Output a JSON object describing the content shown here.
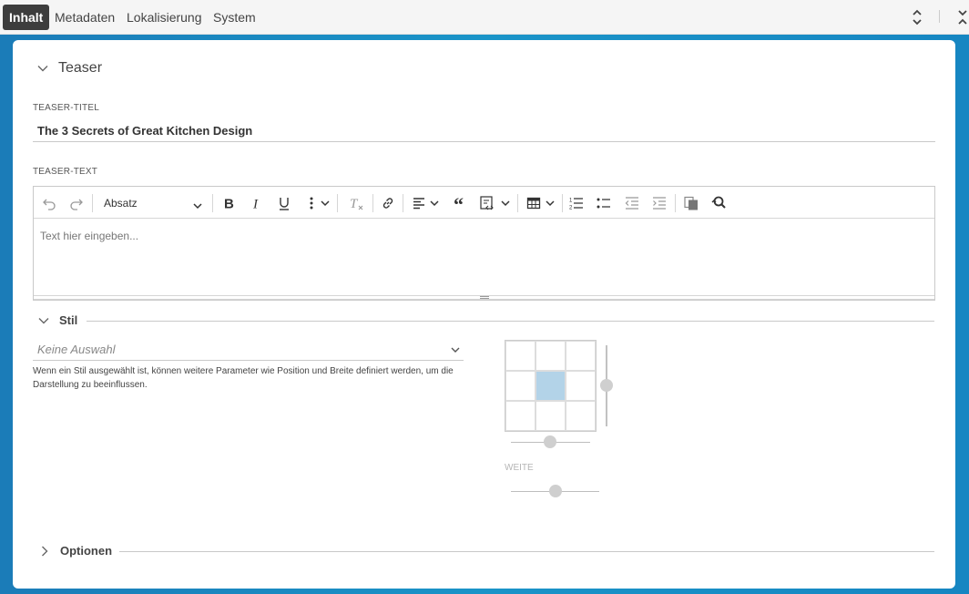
{
  "tabs": [
    {
      "label": "Inhalt",
      "active": true
    },
    {
      "label": "Metadaten",
      "active": false
    },
    {
      "label": "Lokalisierung",
      "active": false
    },
    {
      "label": "System",
      "active": false
    }
  ],
  "teaser": {
    "section_title": "Teaser",
    "title_label": "TEASER-TITEL",
    "title_value": "The 3 Secrets of Great Kitchen Design",
    "text_label": "TEASER-TEXT",
    "editor": {
      "paragraph_format": "Absatz",
      "placeholder": "Text hier eingeben..."
    }
  },
  "stil": {
    "section_title": "Stil",
    "select_value": "Keine Auswahl",
    "help_text": "Wenn ein Stil ausgewählt ist, können weitere Parameter wie Position und Breite definiert werden, um die Darstellung zu beeinflussen.",
    "position_grid": {
      "rows": 3,
      "cols": 3,
      "selected_row": 1,
      "selected_col": 1
    },
    "width_label": "WEITE"
  },
  "optionen": {
    "section_title": "Optionen"
  },
  "colors": {
    "accent_blue": "#1a94c8",
    "active_tab": "#3d3d3d",
    "grid_selected": "#b3d3e8"
  }
}
